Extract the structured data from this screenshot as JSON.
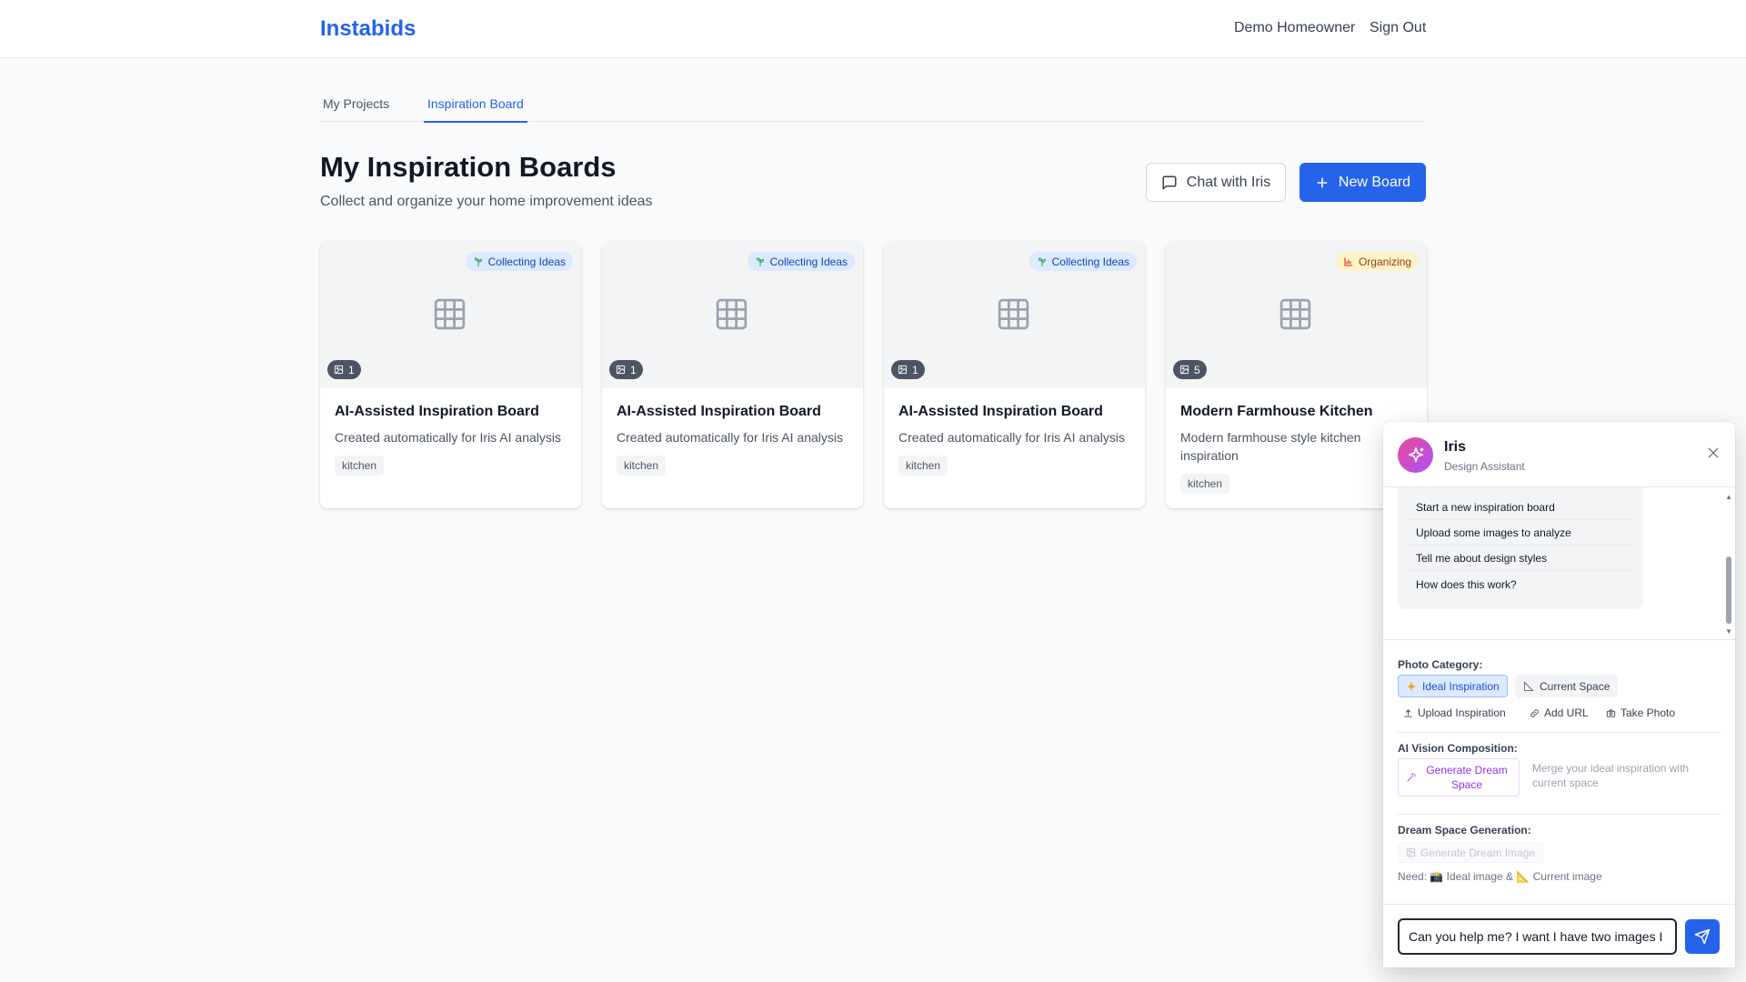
{
  "header": {
    "brand": "Instabids",
    "user_name": "Demo Homeowner",
    "sign_out": "Sign Out"
  },
  "tabs": [
    {
      "label": "My Projects",
      "active": false
    },
    {
      "label": "Inspiration Board",
      "active": true
    }
  ],
  "page": {
    "title": "My Inspiration Boards",
    "subtitle": "Collect and organize your home improvement ideas",
    "chat_button": "Chat with Iris",
    "new_board_button": "New Board"
  },
  "boards": [
    {
      "title": "AI-Assisted Inspiration Board",
      "description": "Created automatically for Iris AI analysis",
      "status": "Collecting Ideas",
      "image_count": "1",
      "tag": "kitchen"
    },
    {
      "title": "AI-Assisted Inspiration Board",
      "description": "Created automatically for Iris AI analysis",
      "status": "Collecting Ideas",
      "image_count": "1",
      "tag": "kitchen"
    },
    {
      "title": "AI-Assisted Inspiration Board",
      "description": "Created automatically for Iris AI analysis",
      "status": "Collecting Ideas",
      "image_count": "1",
      "tag": "kitchen"
    },
    {
      "title": "Modern Farmhouse Kitchen",
      "description": "Modern farmhouse style kitchen inspiration",
      "status": "Organizing",
      "image_count": "5",
      "tag": "kitchen"
    }
  ],
  "iris": {
    "name": "Iris",
    "role": "Design Assistant",
    "suggestions": [
      "Start a new inspiration board",
      "Upload some images to analyze",
      "Tell me about design styles",
      "How does this work?"
    ],
    "photo_category_label": "Photo Category:",
    "ideal_inspiration": "Ideal Inspiration",
    "current_space": "Current Space",
    "upload_inspiration": "Upload Inspiration",
    "add_url": "Add URL",
    "take_photo": "Take Photo",
    "ai_vision_label": "AI Vision Composition:",
    "generate_dream_space": "Generate Dream Space",
    "merge_note": "Merge your ideal inspiration with current space",
    "dream_generation_label": "Dream Space Generation:",
    "generate_dream_image": "Generate Dream Image",
    "need_note": "Need: 📸 Ideal image & 📐 Current image",
    "input_value": "Can you help me? I want I have two images I want"
  },
  "colors": {
    "primary": "#2563eb",
    "collecting_badge_bg": "#dbeafe",
    "organizing_badge_bg": "#fef3c7",
    "iris_gradient_start": "#ec4899",
    "iris_gradient_end": "#a855f7",
    "dream_purple": "#9333ea"
  },
  "icons": {
    "board_placeholder": "grid-icon",
    "chat": "message-square-icon",
    "new": "plus-icon",
    "collecting": "sprout-icon",
    "organizing": "chart-icon",
    "count": "image-icon",
    "iris_avatar": "sparkles-icon",
    "close": "x-icon",
    "upload": "upload-icon",
    "link": "link-icon",
    "camera": "camera-icon",
    "send": "send-icon"
  }
}
